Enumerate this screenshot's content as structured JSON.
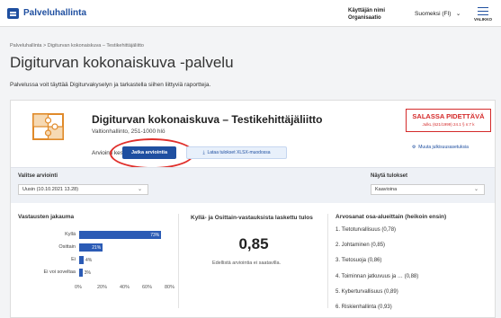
{
  "header": {
    "app_title": "Palveluhallinta",
    "user_name": "Käyttäjän nimi",
    "organization": "Organisaatio",
    "language": "Suomeksi (FI)",
    "menu_label": "VALIKKO"
  },
  "breadcrumb": "Palveluhallinta > Digiturvan kokonaiskuva – Testikehittäjäliitto",
  "page": {
    "title": "Digiturvan kokonaiskuva -palvelu",
    "description": "Palvelussa voit täyttää Digiturvakyselyn ja tarkastella siihen liittyviä raportteja."
  },
  "service": {
    "name": "Digiturvan kokonaiskuva – Testikehittäjäliitto",
    "subtitle": "Valtionhallinto, 251-1000 hlö",
    "secret_title": "SALASSA PIDETTÄVÄ",
    "secret_sub": "JulkL (621/1999) 24.1 § n:7 k",
    "visibility_link": "Muuta julkisuusasetuksia",
    "eval_label": "Arviointi kesken",
    "continue_button": "Jatka arviointia",
    "download_button": "Lataa tulokset XLSX-muodossa"
  },
  "filters": {
    "select_label": "Valitse arviointi",
    "select_value": "Uusin (10.10.2021 13.28)",
    "show_label": "Näytä tulokset",
    "show_value": "Kaavioina"
  },
  "answers": {
    "title": "Vastausten jakauma"
  },
  "chart_data": {
    "type": "bar",
    "orientation": "horizontal",
    "categories": [
      "Kyllä",
      "Osittain",
      "Ei",
      "Ei voi soveltaa"
    ],
    "values": [
      73,
      21,
      4,
      3
    ],
    "value_labels": [
      "73%",
      "21%",
      "4%",
      "3%"
    ],
    "xlim": [
      0,
      80
    ],
    "x_ticks": [
      "0%",
      "20%",
      "40%",
      "60%",
      "80%"
    ],
    "color": "#2b5bb5"
  },
  "result": {
    "title": "Kyllä- ja Osittain-vastauksista laskettu tulos",
    "value": "0,85",
    "note": "Edellistä arviointia ei saatavilla."
  },
  "scores": {
    "title": "Arvosanat osa-alueittain (heikoin ensin)",
    "items": [
      "1. Tietoturvallisuus (0,78)",
      "2. Johtaminen (0,85)",
      "3. Tietosuoja (0,86)",
      "4. Toiminnan jatkuvuus ja … (0,88)",
      "5. Kyberturvallisuus (0,89)",
      "6. Riskienhallinta (0,93)"
    ]
  },
  "colors": {
    "brand": "#1f4fa0",
    "secret": "#d42a2a",
    "highlight": "#e0302c"
  }
}
